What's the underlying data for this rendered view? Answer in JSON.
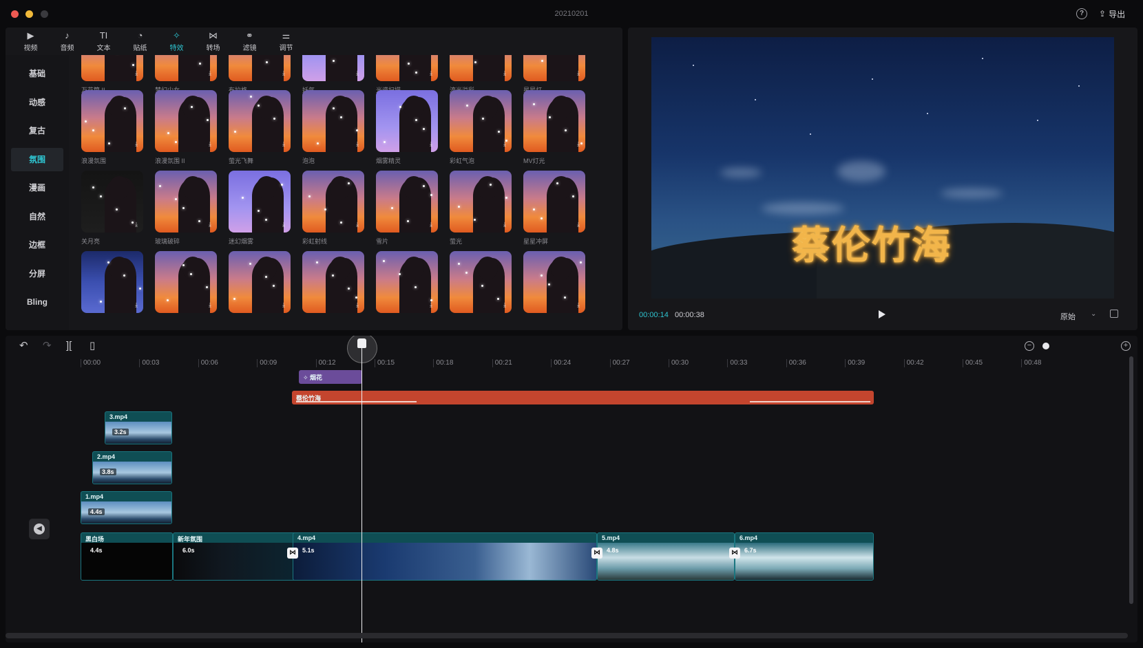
{
  "window": {
    "title": "20210201",
    "export_label": "导出"
  },
  "media": {
    "tabs": [
      {
        "label": "视频",
        "icon": "video-icon",
        "glyph": "▶"
      },
      {
        "label": "音频",
        "icon": "audio-icon",
        "glyph": "♪"
      },
      {
        "label": "文本",
        "icon": "text-icon",
        "glyph": "TI"
      },
      {
        "label": "贴纸",
        "icon": "sticker-icon",
        "glyph": "◔"
      },
      {
        "label": "特效",
        "icon": "effects-icon",
        "glyph": "✧",
        "active": true
      },
      {
        "label": "转场",
        "icon": "transition-icon",
        "glyph": "⋈"
      },
      {
        "label": "滤镜",
        "icon": "filter-icon",
        "glyph": "⚭"
      },
      {
        "label": "调节",
        "icon": "adjust-icon",
        "glyph": "⚌"
      }
    ],
    "categories": [
      "基础",
      "动感",
      "复古",
      "氛围",
      "漫画",
      "自然",
      "边框",
      "分屏",
      "Bling"
    ],
    "active_category": "氛围",
    "effects": [
      {
        "name": "万花筒 II",
        "style": ""
      },
      {
        "name": "梦幻少女",
        "style": ""
      },
      {
        "name": "布拉格",
        "style": ""
      },
      {
        "name": "妖气",
        "style": "purple"
      },
      {
        "name": "光谱扫描",
        "style": ""
      },
      {
        "name": "流光溢彩",
        "style": ""
      },
      {
        "name": "星星灯",
        "style": ""
      },
      {
        "name": "浪漫氛围",
        "style": ""
      },
      {
        "name": "浪漫氛围 II",
        "style": ""
      },
      {
        "name": "萤光飞舞",
        "style": ""
      },
      {
        "name": "泡泡",
        "style": ""
      },
      {
        "name": "烟雾精灵",
        "style": "purple"
      },
      {
        "name": "彩虹气泡",
        "style": ""
      },
      {
        "name": "MV灯光",
        "style": ""
      },
      {
        "name": "关月亮",
        "style": "dark"
      },
      {
        "name": "玻璃破碎",
        "style": ""
      },
      {
        "name": "迷幻烟雾",
        "style": "purple"
      },
      {
        "name": "彩虹射线",
        "style": ""
      },
      {
        "name": "雪片",
        "style": ""
      },
      {
        "name": "萤光",
        "style": ""
      },
      {
        "name": "星星冲屏",
        "style": ""
      },
      {
        "name": "",
        "style": "blue"
      },
      {
        "name": "",
        "style": ""
      },
      {
        "name": "",
        "style": ""
      },
      {
        "name": "",
        "style": ""
      },
      {
        "name": "",
        "style": ""
      },
      {
        "name": "",
        "style": ""
      },
      {
        "name": "",
        "style": ""
      }
    ]
  },
  "preview": {
    "overlay_text": "蔡伦竹海",
    "current_time": "00:00:14",
    "total_time": "00:00:38",
    "ratio_label": "原始"
  },
  "timeline": {
    "ruler": [
      "00:00",
      "00:03",
      "00:06",
      "00:09",
      "00:12",
      "00:15",
      "00:18",
      "00:21",
      "00:24",
      "00:27",
      "00:30",
      "00:33",
      "00:36",
      "00:39",
      "00:42",
      "00:45",
      "00:48"
    ],
    "effect_clip": {
      "label": "✧ 烟花"
    },
    "text_clip": {
      "label": "蔡伦竹海"
    },
    "overlay_clips": [
      {
        "name": "3.mp4",
        "duration": "3.2s"
      },
      {
        "name": "2.mp4",
        "duration": "3.8s"
      },
      {
        "name": "1.mp4",
        "duration": "4.4s"
      }
    ],
    "main_clips": [
      {
        "name": "黑白场",
        "duration": "4.4s"
      },
      {
        "name": "新年氛围",
        "duration": "6.0s"
      },
      {
        "name": "4.mp4",
        "duration": "5.1s"
      },
      {
        "name": "5.mp4",
        "duration": "4.8s"
      },
      {
        "name": "6.mp4",
        "duration": "6.7s"
      }
    ]
  },
  "colors": {
    "accent": "#2ec4d0",
    "text_track": "#c4452e",
    "effect_track": "#6b4c9a",
    "video_track": "#0f4e54"
  }
}
